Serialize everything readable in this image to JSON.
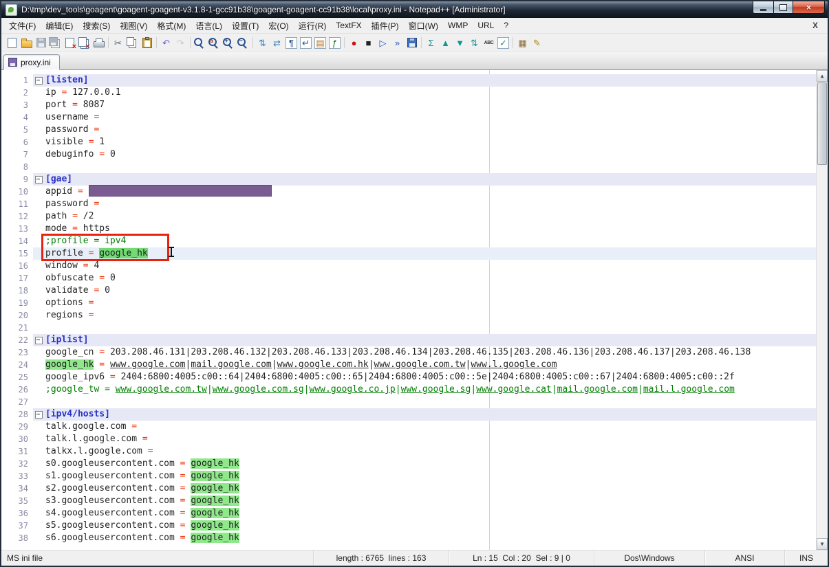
{
  "window": {
    "title": "D:\\tmp\\dev_tools\\goagent\\goagent-goagent-v3.1.8-1-gcc91b38\\goagent-goagent-cc91b38\\local\\proxy.ini - Notepad++ [Administrator]",
    "controls": {
      "minimize": "",
      "maximize": "",
      "close": "×"
    }
  },
  "menu": {
    "items": [
      {
        "id": "file",
        "label": "文件(F)"
      },
      {
        "id": "edit",
        "label": "编辑(E)"
      },
      {
        "id": "search",
        "label": "搜索(S)"
      },
      {
        "id": "view",
        "label": "视图(V)"
      },
      {
        "id": "format",
        "label": "格式(M)"
      },
      {
        "id": "language",
        "label": "语言(L)"
      },
      {
        "id": "settings",
        "label": "设置(T)"
      },
      {
        "id": "macro",
        "label": "宏(O)"
      },
      {
        "id": "run",
        "label": "运行(R)"
      },
      {
        "id": "textfx",
        "label": "TextFX"
      },
      {
        "id": "plugins",
        "label": "插件(P)"
      },
      {
        "id": "window",
        "label": "窗口(W)"
      },
      {
        "id": "wmp",
        "label": "WMP"
      },
      {
        "id": "url",
        "label": "URL"
      },
      {
        "id": "help",
        "label": "?"
      }
    ],
    "close_label": "X"
  },
  "toolbar": {
    "icons": [
      {
        "name": "new-file-icon",
        "kind": "shape",
        "shape": "s-page"
      },
      {
        "name": "open-folder-icon",
        "kind": "shape",
        "shape": "s-folder"
      },
      {
        "name": "save-file-icon",
        "kind": "shape",
        "shape": "s-floppy",
        "dim": true
      },
      {
        "name": "save-all-icon",
        "kind": "shape",
        "shape": "s-floppy-all",
        "dim": true
      },
      {
        "name": "close-file-icon",
        "kind": "shape",
        "shape": "s-page-close"
      },
      {
        "name": "close-all-icon",
        "kind": "shape",
        "shape": "s-page-close-all"
      },
      {
        "name": "print-icon",
        "kind": "shape",
        "shape": "s-printer"
      },
      {
        "name": "separator",
        "kind": "sep"
      },
      {
        "name": "cut-icon",
        "kind": "glyph",
        "glyph": "✂",
        "color": "#54657a"
      },
      {
        "name": "copy-icon",
        "kind": "shape",
        "shape": "s-copy"
      },
      {
        "name": "paste-icon",
        "kind": "shape",
        "shape": "s-paste"
      },
      {
        "name": "separator",
        "kind": "sep"
      },
      {
        "name": "undo-icon",
        "kind": "glyph",
        "glyph": "↶",
        "color": "#6a5acd"
      },
      {
        "name": "redo-icon",
        "kind": "glyph",
        "glyph": "↷",
        "color": "#8a97a5",
        "dim": true
      },
      {
        "name": "separator",
        "kind": "sep"
      },
      {
        "name": "find-icon",
        "kind": "shape",
        "shape": "s-magnifier"
      },
      {
        "name": "replace-icon",
        "kind": "shape",
        "shape": "s-magnifier-replace"
      },
      {
        "name": "zoom-in-icon",
        "kind": "shape",
        "shape": "s-magnifier-plus"
      },
      {
        "name": "zoom-out-icon",
        "kind": "shape",
        "shape": "s-magnifier-minus"
      },
      {
        "name": "separator",
        "kind": "sep"
      },
      {
        "name": "sync-scroll-vertical-icon",
        "kind": "glyph",
        "glyph": "⇅",
        "color": "#3a7abf"
      },
      {
        "name": "sync-scroll-horizontal-icon",
        "kind": "glyph",
        "glyph": "⇄",
        "color": "#3a7abf"
      },
      {
        "name": "show-all-characters-icon",
        "kind": "glyph",
        "glyph": "¶",
        "color": "#27518f",
        "boxed": true
      },
      {
        "name": "word-wrap-icon",
        "kind": "glyph",
        "glyph": "↵",
        "color": "#27518f",
        "boxed": true
      },
      {
        "name": "doc-map-icon",
        "kind": "glyph",
        "glyph": "▤",
        "color": "#b8762a",
        "boxed": true
      },
      {
        "name": "function-list-icon",
        "kind": "glyph",
        "glyph": "ƒ",
        "color": "#2f6f2f",
        "boxed": true
      },
      {
        "name": "separator",
        "kind": "sep"
      },
      {
        "name": "record-macro-icon",
        "kind": "glyph",
        "glyph": "●",
        "color": "#cc1111"
      },
      {
        "name": "stop-macro-icon",
        "kind": "glyph",
        "glyph": "■",
        "color": "#222222"
      },
      {
        "name": "play-macro-icon",
        "kind": "glyph",
        "glyph": "▷",
        "color": "#2255bb"
      },
      {
        "name": "run-macro-multiple-icon",
        "kind": "glyph",
        "glyph": "»",
        "color": "#2255bb"
      },
      {
        "name": "save-macro-icon",
        "kind": "shape",
        "shape": "s-floppy"
      },
      {
        "name": "separator",
        "kind": "sep"
      },
      {
        "name": "textfx-sum-icon",
        "kind": "glyph",
        "glyph": "Σ",
        "color": "#0e9494"
      },
      {
        "name": "sort-ascending-icon",
        "kind": "glyph",
        "glyph": "▲",
        "color": "#0e9494"
      },
      {
        "name": "sort-descending-icon",
        "kind": "glyph",
        "glyph": "▼",
        "color": "#0e9494"
      },
      {
        "name": "sort-lines-icon",
        "kind": "glyph",
        "glyph": "⇅",
        "color": "#0e9494"
      },
      {
        "name": "spell-check-icon",
        "kind": "text",
        "glyph": "ABC",
        "color": "#333333"
      },
      {
        "name": "spell-check-ok-icon",
        "kind": "glyph",
        "glyph": "✓",
        "color": "#0e9494",
        "boxed": true
      },
      {
        "name": "separator",
        "kind": "sep"
      },
      {
        "name": "docs-book-icon",
        "kind": "glyph",
        "glyph": "▦",
        "color": "#8a6d3b"
      },
      {
        "name": "edit-pencil-icon",
        "kind": "glyph",
        "glyph": "✎",
        "color": "#b8860b"
      }
    ]
  },
  "tabs": [
    {
      "id": "proxy-ini",
      "label": "proxy.ini",
      "active": true
    }
  ],
  "editor": {
    "lines": [
      {
        "n": 1,
        "bg": "section",
        "fold": true,
        "segs": [
          [
            "section",
            "[listen]"
          ]
        ]
      },
      {
        "n": 2,
        "segs": [
          [
            "key",
            "ip"
          ],
          [
            "eq",
            " = "
          ],
          [
            "val",
            "127.0.0.1"
          ]
        ]
      },
      {
        "n": 3,
        "segs": [
          [
            "key",
            "port"
          ],
          [
            "eq",
            " = "
          ],
          [
            "val",
            "8087"
          ]
        ]
      },
      {
        "n": 4,
        "segs": [
          [
            "key",
            "username"
          ],
          [
            "eq",
            " ="
          ]
        ]
      },
      {
        "n": 5,
        "segs": [
          [
            "key",
            "password"
          ],
          [
            "eq",
            " ="
          ]
        ]
      },
      {
        "n": 6,
        "segs": [
          [
            "key",
            "visible"
          ],
          [
            "eq",
            " = "
          ],
          [
            "val",
            "1"
          ]
        ]
      },
      {
        "n": 7,
        "segs": [
          [
            "key",
            "debuginfo"
          ],
          [
            "eq",
            " = "
          ],
          [
            "val",
            "0"
          ]
        ]
      },
      {
        "n": 8,
        "segs": []
      },
      {
        "n": 9,
        "bg": "section",
        "fold": true,
        "segs": [
          [
            "section",
            "[gae]"
          ]
        ]
      },
      {
        "n": 10,
        "segs": [
          [
            "key",
            "appid"
          ],
          [
            "eq",
            " = "
          ],
          [
            "redact",
            ""
          ]
        ]
      },
      {
        "n": 11,
        "segs": [
          [
            "key",
            "password"
          ],
          [
            "eq",
            " ="
          ]
        ]
      },
      {
        "n": 12,
        "segs": [
          [
            "key",
            "path"
          ],
          [
            "eq",
            " = "
          ],
          [
            "val",
            "/2"
          ]
        ]
      },
      {
        "n": 13,
        "segs": [
          [
            "key",
            "mode"
          ],
          [
            "eq",
            " = "
          ],
          [
            "val",
            "https"
          ]
        ]
      },
      {
        "n": 14,
        "segs": [
          [
            "comment",
            ";profile = ipv4"
          ]
        ]
      },
      {
        "n": 15,
        "bg": "current",
        "segs": [
          [
            "key",
            "profile"
          ],
          [
            "eq",
            " = "
          ],
          [
            "sel",
            "google_hk"
          ]
        ]
      },
      {
        "n": 16,
        "segs": [
          [
            "key",
            "window"
          ],
          [
            "eq",
            " = "
          ],
          [
            "val",
            "4"
          ]
        ]
      },
      {
        "n": 17,
        "segs": [
          [
            "key",
            "obfuscate"
          ],
          [
            "eq",
            " = "
          ],
          [
            "val",
            "0"
          ]
        ]
      },
      {
        "n": 18,
        "segs": [
          [
            "key",
            "validate"
          ],
          [
            "eq",
            " = "
          ],
          [
            "val",
            "0"
          ]
        ]
      },
      {
        "n": 19,
        "segs": [
          [
            "key",
            "options"
          ],
          [
            "eq",
            " ="
          ]
        ]
      },
      {
        "n": 20,
        "segs": [
          [
            "key",
            "regions"
          ],
          [
            "eq",
            " ="
          ]
        ]
      },
      {
        "n": 21,
        "segs": []
      },
      {
        "n": 22,
        "bg": "section",
        "fold": true,
        "segs": [
          [
            "section",
            "[iplist]"
          ]
        ]
      },
      {
        "n": 23,
        "segs": [
          [
            "key",
            "google_cn"
          ],
          [
            "eq",
            " = "
          ],
          [
            "val",
            "203.208.46.131|203.208.46.132|203.208.46.133|203.208.46.134|203.208.46.135|203.208.46.136|203.208.46.137|203.208.46.138"
          ]
        ]
      },
      {
        "n": 24,
        "segs": [
          [
            "hl",
            "google_hk"
          ],
          [
            "eq",
            " = "
          ],
          [
            "url",
            "www.google.com"
          ],
          [
            "val",
            "|"
          ],
          [
            "url",
            "mail.google.com"
          ],
          [
            "val",
            "|"
          ],
          [
            "url",
            "www.google.com.hk"
          ],
          [
            "val",
            "|"
          ],
          [
            "url",
            "www.google.com.tw"
          ],
          [
            "val",
            "|"
          ],
          [
            "url",
            "www.l.google.com"
          ]
        ]
      },
      {
        "n": 25,
        "segs": [
          [
            "key",
            "google_ipv6"
          ],
          [
            "eq",
            " = "
          ],
          [
            "val",
            "2404:6800:4005:c00::64|2404:6800:4005:c00::65|2404:6800:4005:c00::5e|2404:6800:4005:c00::67|2404:6800:4005:c00::2f"
          ]
        ]
      },
      {
        "n": 26,
        "segs": [
          [
            "comment",
            ";google_tw = "
          ],
          [
            "curl",
            "www.google.com.tw"
          ],
          [
            "comment",
            "|"
          ],
          [
            "curl",
            "www.google.com.sg"
          ],
          [
            "comment",
            "|"
          ],
          [
            "curl",
            "www.google.co.jp"
          ],
          [
            "comment",
            "|"
          ],
          [
            "curl",
            "www.google.sg"
          ],
          [
            "comment",
            "|"
          ],
          [
            "curl",
            "www.google.cat"
          ],
          [
            "comment",
            "|"
          ],
          [
            "curl",
            "mail.google.com"
          ],
          [
            "comment",
            "|"
          ],
          [
            "curl",
            "mail.l.google.com"
          ]
        ]
      },
      {
        "n": 27,
        "segs": []
      },
      {
        "n": 28,
        "bg": "section",
        "fold": true,
        "segs": [
          [
            "section",
            "[ipv4/hosts]"
          ]
        ]
      },
      {
        "n": 29,
        "segs": [
          [
            "key",
            "talk.google.com"
          ],
          [
            "eq",
            " ="
          ]
        ]
      },
      {
        "n": 30,
        "segs": [
          [
            "key",
            "talk.l.google.com"
          ],
          [
            "eq",
            " ="
          ]
        ]
      },
      {
        "n": 31,
        "segs": [
          [
            "key",
            "talkx.l.google.com"
          ],
          [
            "eq",
            " ="
          ]
        ]
      },
      {
        "n": 32,
        "segs": [
          [
            "key",
            "s0.googleusercontent.com"
          ],
          [
            "eq",
            " = "
          ],
          [
            "hl",
            "google_hk"
          ]
        ]
      },
      {
        "n": 33,
        "segs": [
          [
            "key",
            "s1.googleusercontent.com"
          ],
          [
            "eq",
            " = "
          ],
          [
            "hl",
            "google_hk"
          ]
        ]
      },
      {
        "n": 34,
        "segs": [
          [
            "key",
            "s2.googleusercontent.com"
          ],
          [
            "eq",
            " = "
          ],
          [
            "hl",
            "google_hk"
          ]
        ]
      },
      {
        "n": 35,
        "segs": [
          [
            "key",
            "s3.googleusercontent.com"
          ],
          [
            "eq",
            " = "
          ],
          [
            "hl",
            "google_hk"
          ]
        ]
      },
      {
        "n": 36,
        "segs": [
          [
            "key",
            "s4.googleusercontent.com"
          ],
          [
            "eq",
            " = "
          ],
          [
            "hl",
            "google_hk"
          ]
        ]
      },
      {
        "n": 37,
        "segs": [
          [
            "key",
            "s5.googleusercontent.com"
          ],
          [
            "eq",
            " = "
          ],
          [
            "hl",
            "google_hk"
          ]
        ]
      },
      {
        "n": 38,
        "segs": [
          [
            "key",
            "s6.googleusercontent.com"
          ],
          [
            "eq",
            " = "
          ],
          [
            "hl",
            "google_hk"
          ]
        ]
      }
    ],
    "colors": {
      "section": "#2630c8",
      "equals": "#f32a00",
      "comment": "#008000",
      "word_highlight_bg": "#8fe88a",
      "selection_bg": "#74d877",
      "redaction_fill": "#7a5b92",
      "annotation_red": "#e8220e",
      "current_line_bg": "#e9eff8",
      "section_row_bg": "#e6e8f6"
    }
  },
  "status_bar": {
    "cells": [
      {
        "id": "doc-type",
        "text": "MS ini file"
      },
      {
        "id": "doc-size",
        "text": "length : 6765  lines : 163"
      },
      {
        "id": "cursor-pos",
        "text": "Ln : 15  Col : 20  Sel : 9 | 0"
      },
      {
        "id": "eol",
        "text": "Dos\\Windows"
      },
      {
        "id": "encoding",
        "text": "ANSI"
      },
      {
        "id": "insert",
        "text": "INS"
      }
    ]
  }
}
